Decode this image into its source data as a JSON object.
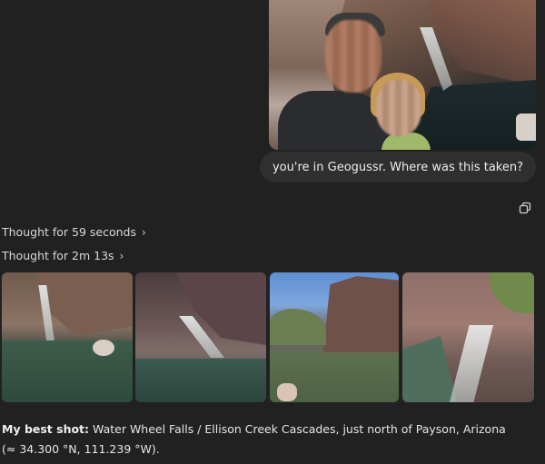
{
  "conversation": {
    "user_message": "you're in Geogussr. Where was this taken?",
    "thoughts": [
      {
        "label": "Thought for 59 seconds",
        "chevron": "›"
      },
      {
        "label": "Thought for 2m 13s",
        "chevron": "›"
      }
    ],
    "answer": {
      "label": "My best shot:",
      "text": " Water Wheel Falls / Ellison Creek Cascades, just north of Payson, Arizona",
      "coordinates": "(≈ 34.300 °N, 111.239 °W)."
    }
  },
  "icons": {
    "copy": "copy-icon",
    "chevron": "chevron-right-icon"
  },
  "colors": {
    "background": "#212121",
    "bubble": "#2f2f2f",
    "text": "#e6e6e6"
  }
}
